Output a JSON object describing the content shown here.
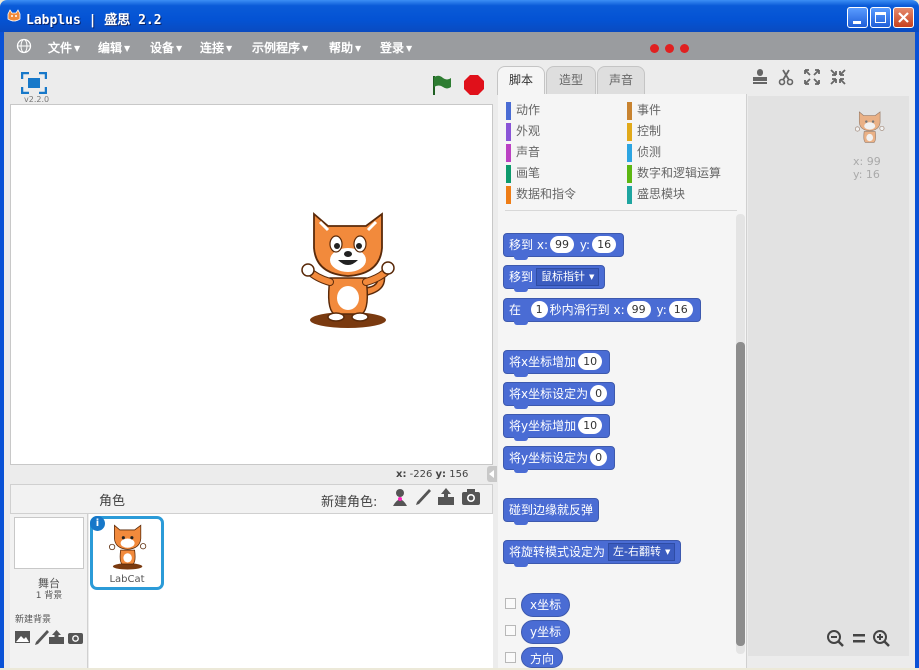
{
  "window": {
    "title": "Labplus | 盛思 2.2"
  },
  "menu": {
    "items": [
      {
        "label": "文件"
      },
      {
        "label": "编辑"
      },
      {
        "label": "设备"
      },
      {
        "label": "连接"
      },
      {
        "label": "示例程序"
      },
      {
        "label": "帮助"
      },
      {
        "label": "登录"
      }
    ]
  },
  "stage": {
    "version": "v2.2.0",
    "mouse_x_label": "x:",
    "mouse_x": "-226",
    "mouse_y_label": "y:",
    "mouse_y": "156"
  },
  "sprites_panel": {
    "title": "角色",
    "new_sprite_label": "新建角色:",
    "stage_label": "舞台",
    "stage_backdrops": "1 背景",
    "new_backdrop_label": "新建背景",
    "sprites": [
      {
        "name": "LabCat",
        "info": "i"
      }
    ]
  },
  "tabs": [
    {
      "label": "脚本",
      "active": true
    },
    {
      "label": "造型"
    },
    {
      "label": "声音"
    }
  ],
  "categories": [
    {
      "label": "动作",
      "color": "#4a6cd4"
    },
    {
      "label": "事件",
      "color": "#c88330"
    },
    {
      "label": "外观",
      "color": "#8a55d7"
    },
    {
      "label": "控制",
      "color": "#e1a91a"
    },
    {
      "label": "声音",
      "color": "#bb42c3"
    },
    {
      "label": "侦测",
      "color": "#2ca5e2"
    },
    {
      "label": "画笔",
      "color": "#0e9a6c"
    },
    {
      "label": "数字和逻辑运算",
      "color": "#5cb712"
    },
    {
      "label": "数据和指令",
      "color": "#ee7d16"
    },
    {
      "label": "盛思模块",
      "color": "#1ea5a0"
    }
  ],
  "blocks": {
    "goto_xy": {
      "text": "移到",
      "x_label": "x:",
      "x": "99",
      "y_label": "y:",
      "y": "16"
    },
    "goto_target": {
      "text": "移到",
      "option": "鼠标指针"
    },
    "glide": {
      "pre": "在",
      "secs": "1",
      "mid": "秒内滑行到",
      "x_label": "x:",
      "x": "99",
      "y_label": "y:",
      "y": "16"
    },
    "change_x": {
      "text": "将x坐标增加",
      "value": "10"
    },
    "set_x": {
      "text": "将x坐标设定为",
      "value": "0"
    },
    "change_y": {
      "text": "将y坐标增加",
      "value": "10"
    },
    "set_y": {
      "text": "将y坐标设定为",
      "value": "0"
    },
    "bounce": {
      "text": "碰到边缘就反弹"
    },
    "rotation_style": {
      "text": "将旋转模式设定为",
      "option": "左-右翻转"
    },
    "x_position": {
      "text": "x坐标"
    },
    "y_position": {
      "text": "y坐标"
    },
    "direction": {
      "text": "方向"
    }
  },
  "scripts_area": {
    "x_label": "x:",
    "x": "99",
    "y_label": "y:",
    "y": "16"
  },
  "colors": {
    "motion": "#4a6cd4",
    "accent_blue": "#2b9bd8",
    "stop_red": "#e0101a",
    "flag_green": "#2e7d32"
  }
}
